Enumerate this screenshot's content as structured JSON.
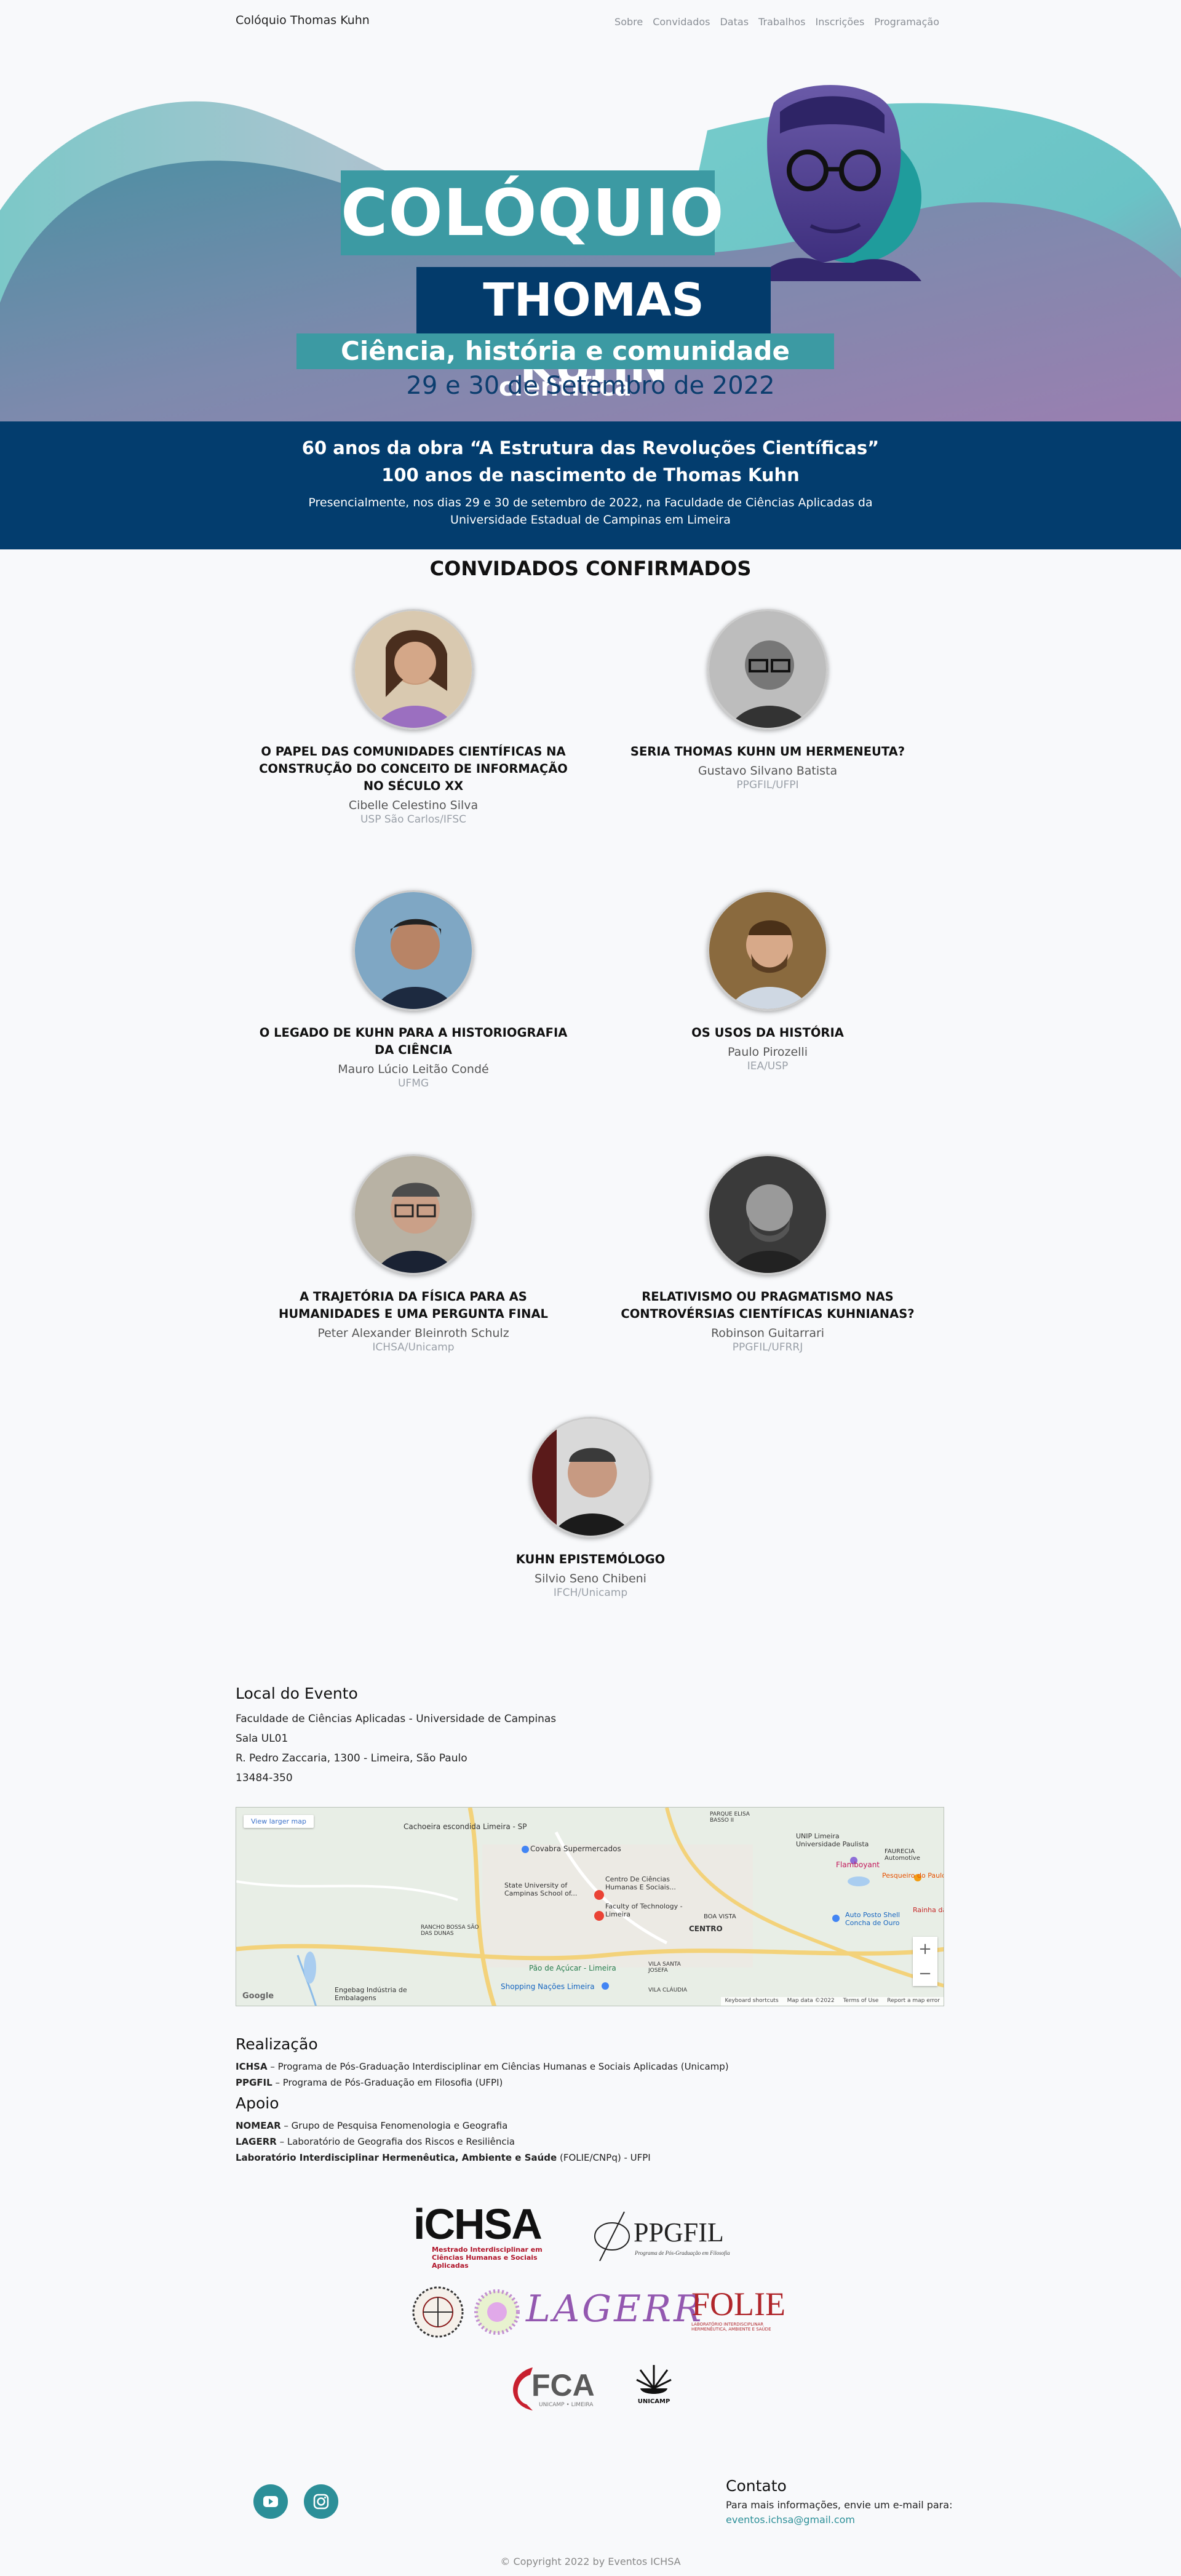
{
  "nav": {
    "brand": "Colóquio Thomas Kuhn",
    "links": [
      "Sobre",
      "Convidados",
      "Datas",
      "Trabalhos",
      "Inscrições",
      "Programação"
    ]
  },
  "hero": {
    "line1": "COLÓQUIO",
    "line2": "THOMAS KUHN",
    "line3": "Ciência, história e comunidade científica",
    "date": "29 e 30 de Setembro de 2022"
  },
  "band": {
    "line1": "60 anos da obra “A Estrutura das Revoluções Científicas”",
    "line2": "100 anos de nascimento de Thomas Kuhn",
    "line3": "Presencialmente, nos dias 29 e 30 de setembro de 2022, na Faculdade de Ciências Aplicadas da Universidade Estadual de Campinas em Limeira"
  },
  "guests_title": "CONVIDADOS CONFIRMADOS",
  "guests": [
    {
      "title": "O PAPEL DAS COMUNIDADES CIENTÍFICAS NA CONSTRUÇÃO DO CONCEITO DE INFORMAÇÃO NO SÉCULO XX",
      "name": "Cibelle Celestino Silva",
      "inst": "USP São Carlos/IFSC"
    },
    {
      "title": "SERIA THOMAS KUHN UM HERMENEUTA?",
      "name": "Gustavo Silvano Batista",
      "inst": "PPGFIL/UFPI"
    },
    {
      "title": "O LEGADO DE KUHN PARA A HISTORIOGRAFIA DA CIÊNCIA",
      "name": "Mauro Lúcio Leitão Condé",
      "inst": "UFMG"
    },
    {
      "title": "OS USOS DA HISTÓRIA",
      "name": "Paulo Pirozelli",
      "inst": "IEA/USP"
    },
    {
      "title": "A TRAJETÓRIA DA FÍSICA PARA AS HUMANIDADES E UMA PERGUNTA FINAL",
      "name": "Peter Alexander Bleinroth Schulz",
      "inst": "ICHSA/Unicamp"
    },
    {
      "title": "RELATIVISMO OU PRAGMATISMO NAS CONTROVÉRSIAS CIENTÍFICAS KUHNIANAS?",
      "name": "Robinson Guitarrari",
      "inst": "PPGFIL/UFRRJ"
    },
    {
      "title": "KUHN EPISTEMÓLOGO",
      "name": "Silvio Seno Chibeni",
      "inst": "IFCH/Unicamp"
    }
  ],
  "venue": {
    "heading": "Local do Evento",
    "lines": [
      "Faculdade de Ciências Aplicadas - Universidade de Campinas",
      "Sala UL01",
      "R. Pedro Zaccaria, 1300 - Limeira, São Paulo",
      "13484-350"
    ],
    "map": {
      "view_larger": "View larger map",
      "zoom_in": "+",
      "zoom_out": "−",
      "google": "Google",
      "footer": [
        "Keyboard shortcuts",
        "Map data ©2022",
        "Terms of Use",
        "Report a map error"
      ],
      "labels": [
        "Cachoeira escondida Limeira - SP",
        "Covabra Supermercados",
        "State University of Campinas School of...",
        "Centro De Ciências Humanas E Sociais...",
        "Faculty of Technology - Limeira",
        "CENTRO",
        "Flamboyant",
        "Pão de Açúcar - Limeira",
        "Shopping Nações Limeira",
        "Engebag Indústria de Embalagens",
        "UNIP Limeira Universidade Paulista",
        "Pesqueiro do Paulo",
        "Auto Posto Shell Concha de Ouro",
        "FAURECIA Automotive",
        "Rainha da",
        "VILA SANTA JOSEFA",
        "RANCHO BOSSA SÃO DAS DUNAS",
        "BOA VISTA",
        "VILA CLÁUDIA",
        "PARQUE ELISA BASSO II"
      ]
    }
  },
  "realizacao": {
    "heading": "Realização",
    "items": [
      {
        "abbr": "ICHSA",
        "desc": " – Programa de Pós-Graduação Interdisciplinar em Ciências Humanas e Sociais Aplicadas (Unicamp)"
      },
      {
        "abbr": "PPGFIL",
        "desc": " – Programa de Pós-Graduação em Filosofia (UFPI)"
      }
    ]
  },
  "apoio": {
    "heading": "Apoio",
    "items": [
      {
        "abbr": "NOMEAR",
        "desc": " – Grupo de Pesquisa Fenomenologia e Geografia"
      },
      {
        "abbr": "LAGERR",
        "desc": " – Laboratório de Geografia dos Riscos e Resiliência"
      },
      {
        "abbr": "Laboratório Interdisciplinar Hermenêutica, Ambiente e Saúde",
        "desc": " (FOLIE/CNPq) - UFPI"
      }
    ]
  },
  "logos": {
    "ichsa": "iCHSA",
    "ichsa_sub1": "Mestrado Interdisciplinar em",
    "ichsa_sub2": "Ciências Humanas e Sociais Aplicadas",
    "ppgfil": "PPGFIL",
    "ppgfil_sub": "Programa de Pós-Graduação em Filosofia",
    "lagerr": "LAGERR",
    "folie": "FOLIE",
    "folie_sub1": "LABORATÓRIO INTERDISCIPLINAR",
    "folie_sub2": "HERMENÊUTICA, AMBIENTE E SAÚDE",
    "fca": "FCA",
    "fca_sub": "UNICAMP • LIMEIRA",
    "unicamp": "UNICAMP"
  },
  "footer": {
    "contact_heading": "Contato",
    "contact_text": "Para mais informações, envie um e-mail para:",
    "contact_email": "eventos.ichsa@gmail.com",
    "copyright": "© Copyright 2022 by Eventos ICHSA"
  },
  "colors": {
    "teal": "#3c9aa3",
    "navy": "#033b6b",
    "band": "#033d6e",
    "link": "#2c8f98"
  }
}
